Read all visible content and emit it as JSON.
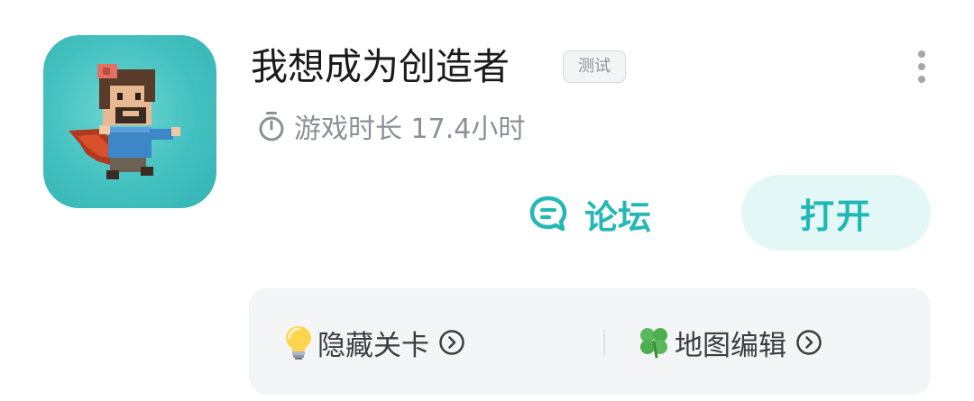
{
  "app": {
    "title": "我想成为创造者",
    "tag": "测试",
    "playtime_label": "游戏时长 17.4小时",
    "icon_name": "pixel-hero-app-icon"
  },
  "actions": {
    "forum_label": "论坛",
    "forum_icon": "chat-bubble-icon",
    "open_label": "打开"
  },
  "features": [
    {
      "label": "隐藏关卡",
      "emoji": "lightbulb-icon"
    },
    {
      "label": "地图编辑",
      "emoji": "clover-icon"
    }
  ],
  "colors": {
    "accent": "#24b8b4",
    "open_bg": "#e3f7f6",
    "icon_bg": "#43c1c0",
    "secondary_text": "#8c9096",
    "panel_bg": "#f4f5f7"
  }
}
